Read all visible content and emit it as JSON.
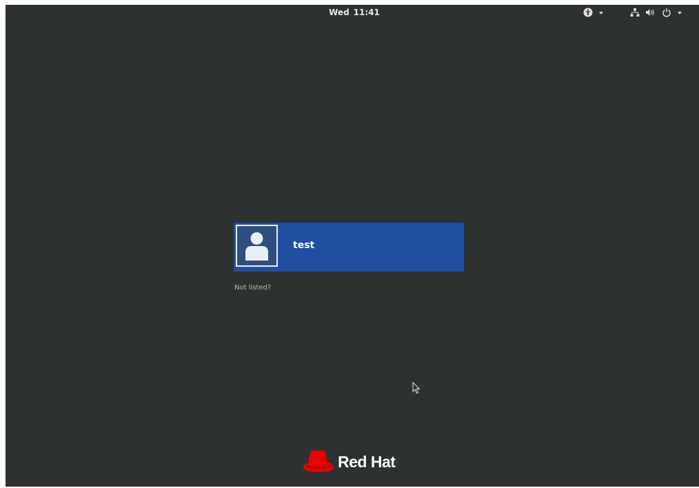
{
  "topbar": {
    "day": "Wed",
    "time": "11:41",
    "icons": [
      "accessibility-icon",
      "network-icon",
      "volume-icon",
      "power-icon"
    ]
  },
  "login": {
    "users": [
      {
        "name": "test",
        "avatar_icon": "user-avatar-icon"
      }
    ],
    "not_listed_label": "Not listed?"
  },
  "branding": {
    "logo_text": "Red Hat"
  },
  "colors": {
    "background": "#2d3131",
    "selected_user": "#1f4f9e",
    "brand_red": "#ee0000"
  }
}
